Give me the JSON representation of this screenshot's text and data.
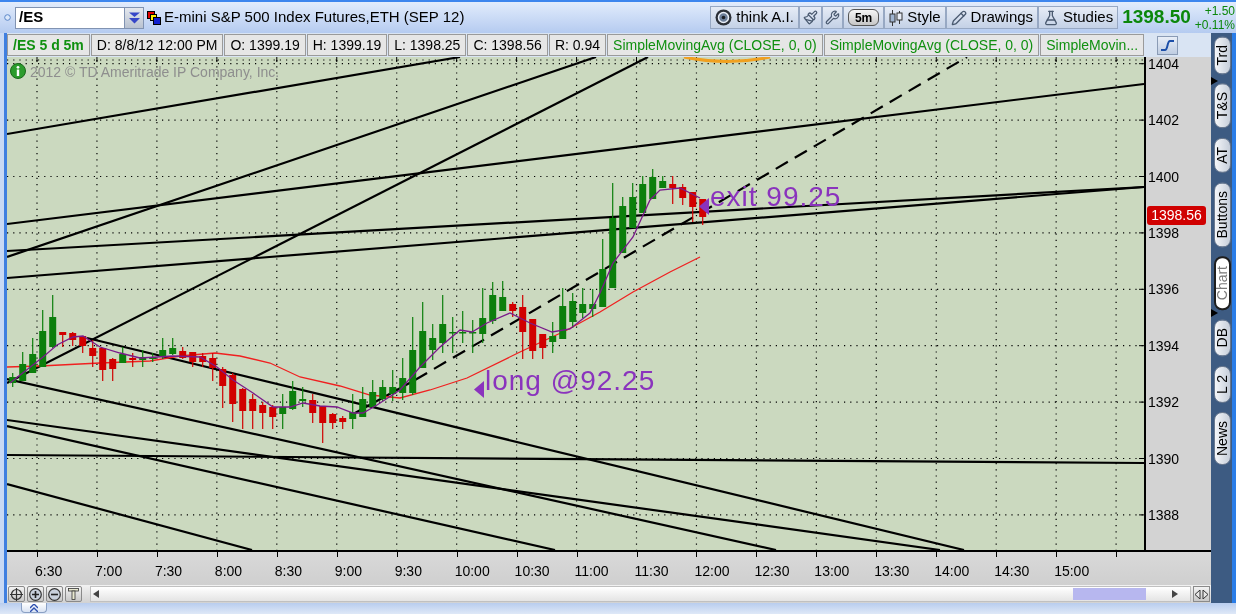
{
  "header": {
    "symbol": "/ES",
    "description": "E-mini S&P 500 Index Futures,ETH (SEP 12)",
    "buttons": [
      {
        "kind": "ai",
        "label": "think A.I."
      },
      {
        "kind": "interval",
        "label": "5m"
      },
      {
        "kind": "style",
        "label": "Style"
      },
      {
        "kind": "drawings",
        "label": "Drawings"
      },
      {
        "kind": "studies",
        "label": "Studies"
      }
    ],
    "last_price": "1398.50",
    "change": "+1.50",
    "change_percent": "+0.11%"
  },
  "info_bar": [
    {
      "kind": "symbol",
      "text": "/ES 5 d 5m"
    },
    {
      "kind": "value",
      "text": "D: 8/8/12 12:00 PM"
    },
    {
      "kind": "value",
      "text": "O: 1399.19"
    },
    {
      "kind": "value",
      "text": "H: 1399.19"
    },
    {
      "kind": "value",
      "text": "L: 1398.25"
    },
    {
      "kind": "value",
      "text": "C: 1398.56"
    },
    {
      "kind": "value",
      "text": "R: 0.94"
    },
    {
      "kind": "study",
      "text": "SimpleMovingAvg (CLOSE, 0, 0)"
    },
    {
      "kind": "study",
      "text": "SimpleMovingAvg (CLOSE, 0, 0)"
    },
    {
      "kind": "study",
      "text": "SimpleMovin..."
    }
  ],
  "chart": {
    "copyright": "2012 © TD Ameritrade IP Company, Inc.",
    "annotations": [
      {
        "text": "long @92.25"
      },
      {
        "text": "exit 99.25"
      }
    ],
    "price_labels": [
      "1404",
      "1402",
      "1400",
      "1398",
      "1396",
      "1394",
      "1392",
      "1390",
      "1388"
    ],
    "last_price_tag": "1398.56",
    "time_labels": [
      "6:30",
      "7:00",
      "7:30",
      "8:00",
      "8:30",
      "9:00",
      "9:30",
      "10:00",
      "10:30",
      "11:00",
      "11:30",
      "12:00",
      "12:30",
      "13:00",
      "13:30",
      "14:00",
      "14:30",
      "15:00"
    ]
  },
  "side_tabs": [
    {
      "label": "Trd",
      "selected": false
    },
    {
      "label": "T&S",
      "selected": false
    },
    {
      "label": "AT",
      "selected": false
    },
    {
      "label": "Buttons",
      "selected": false
    },
    {
      "label": "Chart",
      "selected": true
    },
    {
      "label": "DB",
      "selected": false
    },
    {
      "label": "L 2",
      "selected": false
    },
    {
      "label": "News",
      "selected": false
    }
  ]
}
